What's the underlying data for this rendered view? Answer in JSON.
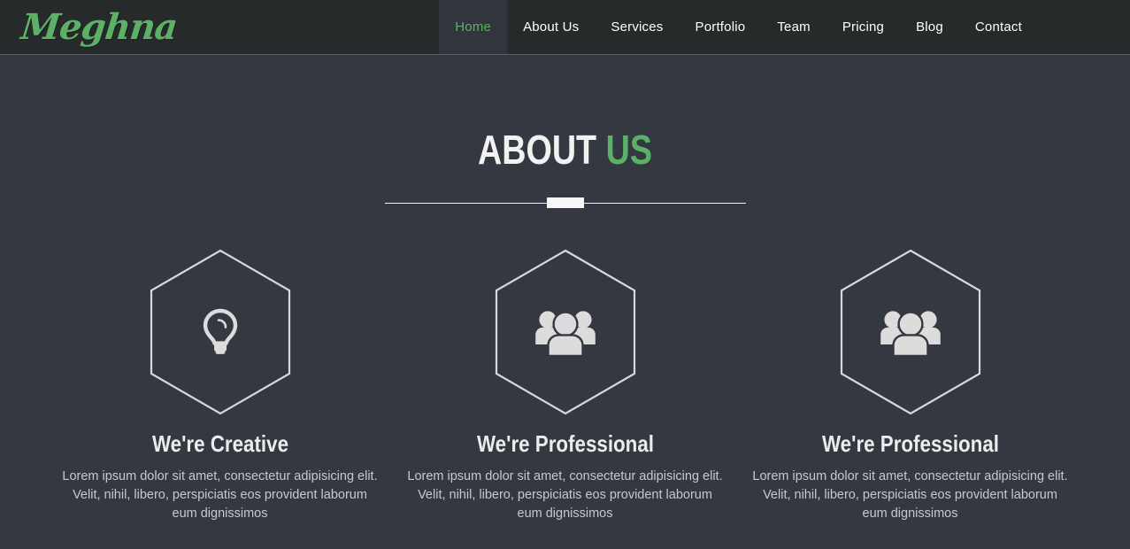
{
  "header": {
    "brand": "Meghna",
    "nav": [
      {
        "label": "Home",
        "active": true
      },
      {
        "label": "About Us",
        "active": false
      },
      {
        "label": "Services",
        "active": false
      },
      {
        "label": "Portfolio",
        "active": false
      },
      {
        "label": "Team",
        "active": false
      },
      {
        "label": "Pricing",
        "active": false
      },
      {
        "label": "Blog",
        "active": false
      },
      {
        "label": "Contact",
        "active": false
      }
    ]
  },
  "section": {
    "title_main": "ABOUT",
    "title_accent": "US",
    "cards": [
      {
        "icon": "lightbulb-icon",
        "title": "We're Creative",
        "text": "Lorem ipsum dolor sit amet, consectetur adipisicing elit. Velit, nihil, libero, perspiciatis eos provident laborum eum dignissimos"
      },
      {
        "icon": "users-group-icon",
        "title": "We're Professional",
        "text": "Lorem ipsum dolor sit amet, consectetur adipisicing elit. Velit, nihil, libero, perspiciatis eos provident laborum eum dignissimos"
      },
      {
        "icon": "users-group-icon",
        "title": "We're Professional",
        "text": "Lorem ipsum dolor sit amet, consectetur adipisicing elit. Velit, nihil, libero, perspiciatis eos provident laborum eum dignissimos"
      }
    ]
  },
  "colors": {
    "header_bg": "#272a2b",
    "body_bg": "#343840",
    "accent_green": "#5cb167",
    "active_nav_bg": "#31353c",
    "hex_stroke": "#d8d8d8",
    "icon_fill": "#dcdcdc",
    "heading": "#f2f2f2",
    "body_text": "#c9c9c9"
  }
}
